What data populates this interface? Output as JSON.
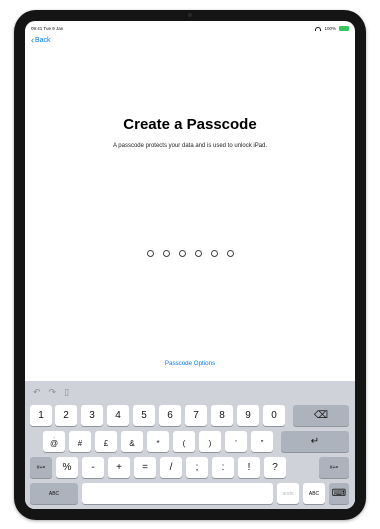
{
  "status_bar": {
    "time_date": "09:41 Tue 9 Jan",
    "battery": "100%"
  },
  "nav": {
    "back_label": "Back"
  },
  "main": {
    "title": "Create a Passcode",
    "subtitle": "A passcode protects your data and is used to unlock iPad.",
    "passcode_options": "Passcode Options"
  },
  "keyboard": {
    "toolbar": {
      "undo_icon": "↶",
      "redo_icon": "↷",
      "paste_icon": "▯"
    },
    "row1": [
      "1",
      "2",
      "3",
      "4",
      "5",
      "6",
      "7",
      "8",
      "9",
      "0"
    ],
    "delete_icon": "⌫",
    "row2_small": [
      "!",
      "",
      "",
      "",
      "",
      "",
      "",
      "",
      ""
    ],
    "row2": [
      "@",
      "#",
      "£",
      "&",
      "*",
      "(",
      ")",
      "'",
      "\""
    ],
    "return_icon": "↵",
    "row3_left": "#+=",
    "row3": [
      "%",
      "-",
      "+",
      "=",
      "/",
      ";",
      ":",
      "!",
      "?"
    ],
    "row3_right": "#+=",
    "bottom": {
      "abc_left": "ABC",
      "undo": "undo",
      "abc_right": "ABC",
      "keyboard_icon": "⌨"
    }
  },
  "colors": {
    "accent": "#007aff",
    "keyboard_bg": "#cfd3d9",
    "battery": "#34c759"
  }
}
